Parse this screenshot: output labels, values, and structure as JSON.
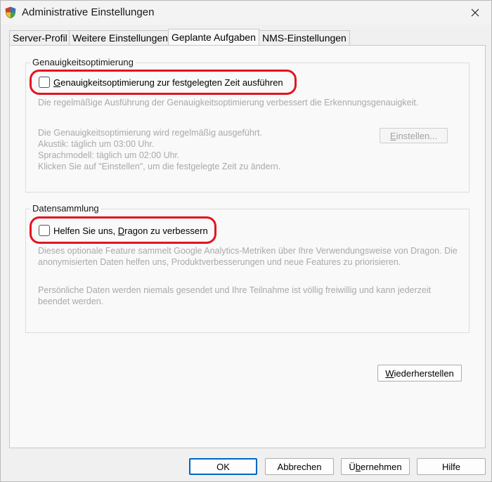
{
  "window": {
    "title": "Administrative Einstellungen",
    "app_icon": "shield-icon",
    "close_icon": "close-icon",
    "highlight_color": "#e2151f",
    "accent_color": "#0067c0"
  },
  "tabs": [
    {
      "label": "Server-Profil",
      "active": false
    },
    {
      "label": "Weitere Einstellungen",
      "active": false
    },
    {
      "label": "Geplante Aufgaben",
      "active": true
    },
    {
      "label": "NMS-Einstellungen",
      "active": false
    }
  ],
  "accuracy": {
    "group_title": "Genauigkeitsoptimierung",
    "checkbox_mnemonic": "G",
    "checkbox_rest": "enauigkeitsoptimierung zur festgelegten Zeit ausführen",
    "checked": false,
    "description": "Die regelmäßige Ausführung der Genauigkeitsoptimierung verbessert die Erkennungsgenauigkeit.",
    "info_lines": [
      "Die Genauigkeitsoptimierung wird regelmäßig ausgeführt.",
      "Akustik: täglich um 03:00 Uhr.",
      "Sprachmodell: täglich um 02:00 Uhr.",
      "Klicken Sie auf \"Einstellen\", um die festgelegte Zeit zu ändern."
    ],
    "set_button_mnemonic": "E",
    "set_button_rest": "instellen..."
  },
  "data_collection": {
    "group_title": "Datensammlung",
    "checkbox_pre": "Helfen Sie uns, ",
    "checkbox_mnemonic": "D",
    "checkbox_rest": "ragon zu verbessern",
    "checked": false,
    "paragraph1": "Dieses optionale Feature sammelt Google Analytics-Metriken über Ihre Verwendungsweise von Dragon. Die anonymisierten Daten helfen uns, Produktverbesserungen und neue Features zu priorisieren.",
    "paragraph2": "Persönliche Daten werden niemals gesendet und Ihre Teilnahme ist völlig freiwillig und kann jederzeit beendet werden."
  },
  "restore_button": {
    "mnemonic": "W",
    "rest": "iederherstellen"
  },
  "footer": {
    "ok": "OK",
    "cancel": "Abbrechen",
    "apply_pre": "Ü",
    "apply_mnemonic": "b",
    "apply_rest": "ernehmen",
    "help": "Hilfe"
  }
}
